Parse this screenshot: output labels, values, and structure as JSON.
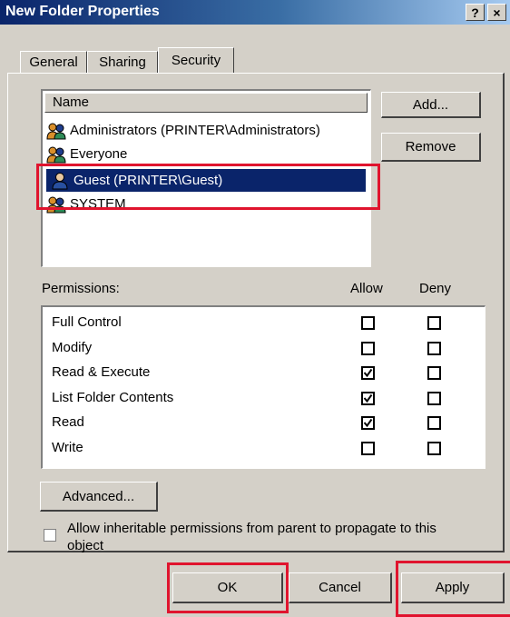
{
  "window": {
    "title": "New Folder Properties",
    "help_label": "?",
    "close_label": "×"
  },
  "tabs": [
    {
      "label": "General",
      "active": false
    },
    {
      "label": "Sharing",
      "active": false
    },
    {
      "label": "Security",
      "active": true
    }
  ],
  "names": {
    "header": "Name",
    "items": [
      {
        "label": "Administrators (PRINTER\\Administrators)",
        "icon": "group-icon",
        "selected": false
      },
      {
        "label": "Everyone",
        "icon": "group-icon",
        "selected": false
      },
      {
        "label": "Guest (PRINTER\\Guest)",
        "icon": "user-icon",
        "selected": true
      },
      {
        "label": "SYSTEM",
        "icon": "group-icon",
        "selected": false
      }
    ],
    "add_label": "Add...",
    "remove_label": "Remove"
  },
  "permissions": {
    "label": "Permissions:",
    "allow_label": "Allow",
    "deny_label": "Deny",
    "rows": [
      {
        "name": "Full Control",
        "allow": false,
        "deny": false
      },
      {
        "name": "Modify",
        "allow": false,
        "deny": false
      },
      {
        "name": "Read & Execute",
        "allow": true,
        "deny": false
      },
      {
        "name": "List Folder Contents",
        "allow": true,
        "deny": false
      },
      {
        "name": "Read",
        "allow": true,
        "deny": false
      },
      {
        "name": "Write",
        "allow": false,
        "deny": false
      }
    ]
  },
  "advanced_label": "Advanced...",
  "inherit": {
    "line1": "Allow inheritable permissions from parent to propagate to this",
    "line2": "object",
    "checked": false
  },
  "buttons": {
    "ok": "OK",
    "cancel": "Cancel",
    "apply": "Apply"
  },
  "highlight_color": "#e0142e",
  "selection_color": "#0a246a"
}
